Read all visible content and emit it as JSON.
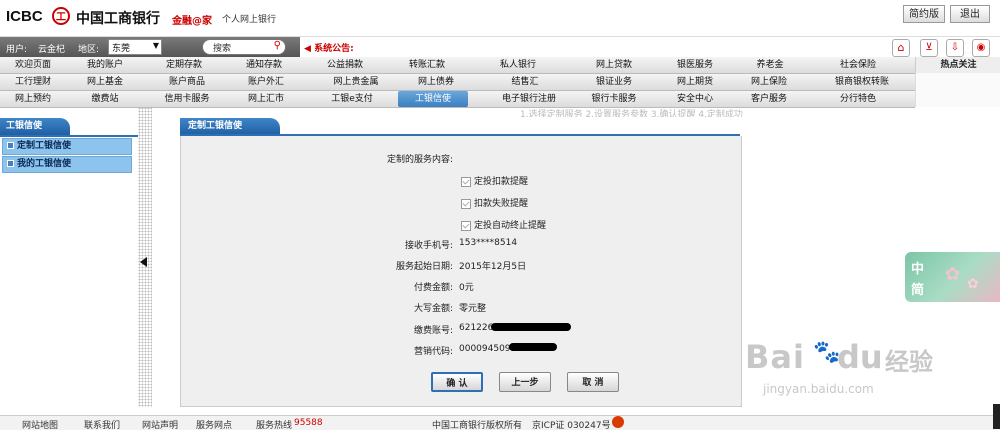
{
  "header": {
    "logo_text": "ICBC",
    "logo_glyph": "工",
    "bank_name": "中国工商银行",
    "slogan": "金融@家",
    "subtitle": "个人网上银行",
    "simple_button": "简约版",
    "logout_button": "退出"
  },
  "userbar": {
    "user_label": "用户:",
    "user_name": "云金杞",
    "region_label": "地区:",
    "region_value": "东莞",
    "search_placeholder": "搜索",
    "notice_label": "系统公告:"
  },
  "nav": {
    "row1": [
      "欢迎页面",
      "我的账户",
      "定期存款",
      "通知存款",
      "公益捐款",
      "转账汇款",
      "私人银行",
      "网上贷款",
      "银医服务",
      "养老金",
      "社会保险"
    ],
    "row2": [
      "工行理财",
      "网上基金",
      "账户商品",
      "账户外汇",
      "网上贵金属",
      "网上债券",
      "结售汇",
      "银证业务",
      "网上期货",
      "网上保险",
      "银商银权转账"
    ],
    "row3": [
      "网上预约",
      "缴费站",
      "信用卡服务",
      "网上汇市",
      "工银e支付",
      "工银信使",
      "电子银行注册",
      "银行卡服务",
      "安全中心",
      "客户服务",
      "分行特色"
    ],
    "hot_label": "热点关注",
    "active_item": "工银信使"
  },
  "sidebar": {
    "title": "工银信使",
    "items": [
      "定制工银信使",
      "我的工银信使"
    ]
  },
  "ghost_steps": "1.选择定制服务    2.设置服务参数    3.确认提醒    4.定制成功",
  "panel": {
    "title": "定制工银信使",
    "service_label": "定制的服务内容:",
    "options": [
      "定投扣款提醒",
      "扣款失败提醒",
      "定投自动终止提醒"
    ],
    "phone_label": "接收手机号:",
    "phone_value": "153****8514",
    "start_date_label": "服务起始日期:",
    "start_date_value": "2015年12月5日",
    "fee_label": "付费金额:",
    "fee_value": "0元",
    "fee_caps_label": "大写金额:",
    "fee_caps_value": "零元整",
    "account_label": "缴费账号:",
    "account_value": "621226",
    "sales_label": "营销代码:",
    "sales_value": "0000945098",
    "confirm_button": "确 认",
    "prev_button": "上一步",
    "cancel_button": "取 消"
  },
  "float_widget": {
    "line1": "中",
    "line2": "简"
  },
  "watermark": {
    "brand": "Bai",
    "brand2": "du",
    "suffix": "经验",
    "url": "jingyan.baidu.com"
  },
  "footer": {
    "links": [
      "网站地图",
      "联系我们",
      "网站声明",
      "服务网点"
    ],
    "hotline_label": "服务热线",
    "hotline_value": "95588",
    "copyright": "中国工商银行版权所有",
    "icp": "京ICP证 030247号"
  },
  "colors": {
    "brand_red": "#c00000",
    "nav_blue": "#2f6fb5",
    "notice_red": "#d00000"
  }
}
